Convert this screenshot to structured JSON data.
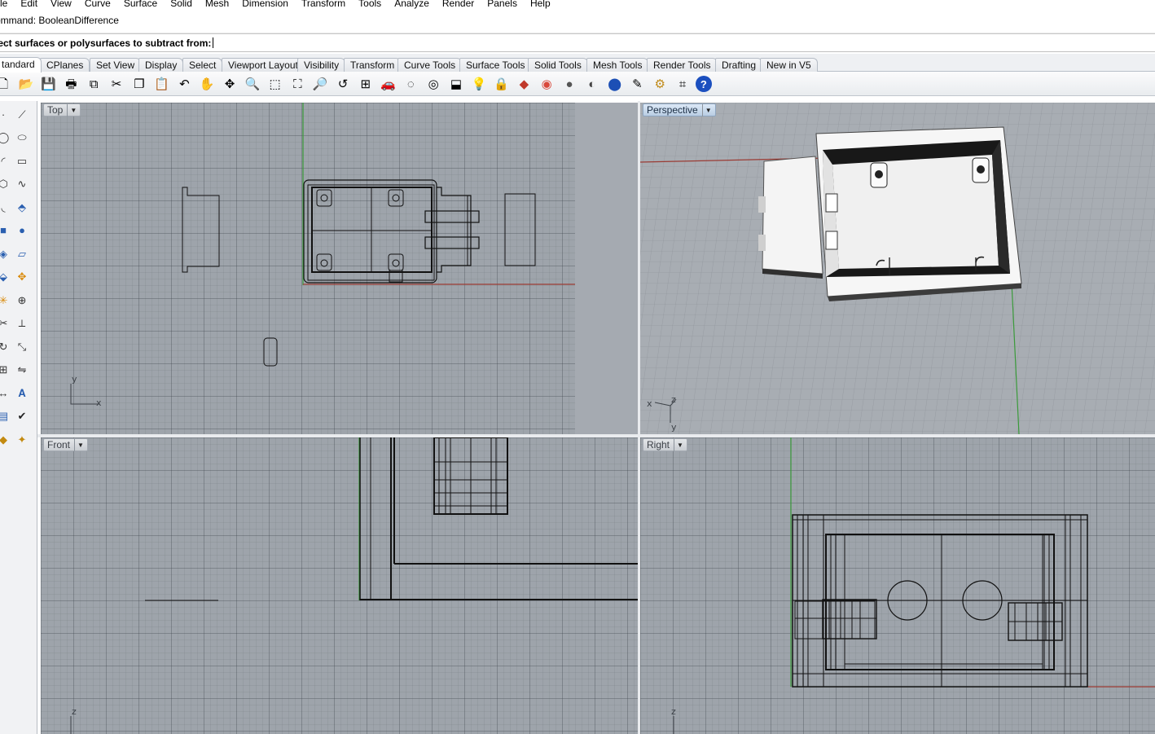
{
  "menu": [
    "le",
    "Edit",
    "View",
    "Curve",
    "Surface",
    "Solid",
    "Mesh",
    "Dimension",
    "Transform",
    "Tools",
    "Analyze",
    "Render",
    "Panels",
    "Help"
  ],
  "command": {
    "history": "ommand: BooleanDifference",
    "prompt": "lect surfaces or polysurfaces to subtract from:"
  },
  "tabs": [
    "tandard",
    "CPlanes",
    "Set View",
    "Display",
    "Select",
    "Viewport Layout",
    "Visibility",
    "Transform",
    "Curve Tools",
    "Surface Tools",
    "Solid Tools",
    "Mesh Tools",
    "Render Tools",
    "Drafting",
    "New in V5"
  ],
  "toolbar_icons": [
    "new-file-icon",
    "open-folder-icon",
    "save-icon",
    "print-icon",
    "import-icon",
    "cut-icon",
    "copy-icon",
    "paste-icon",
    "undo-icon",
    "pan-hand-icon",
    "rotate-view-icon",
    "zoom-dynamic-icon",
    "zoom-window-icon",
    "zoom-extents-icon",
    "zoom-selected-icon",
    "undo-view-icon",
    "four-viewports-icon",
    "car-object-icon",
    "hide-icon",
    "show-icon",
    "select-icon",
    "light-bulb-icon",
    "lock-icon",
    "layers-icon",
    "color-wheel-icon",
    "render-sphere-icon",
    "shaded-sphere-icon",
    "blue-sphere-icon",
    "options-pen-icon",
    "gear-icon",
    "grid-snap-icon",
    "help-icon"
  ],
  "viewports": {
    "top": {
      "label": "Top",
      "axis_x": "x",
      "axis_y": "y"
    },
    "perspective": {
      "label": "Perspective",
      "axis_x": "x",
      "axis_y": "y",
      "axis_z": "z"
    },
    "front": {
      "label": "Front",
      "axis_z": "z"
    },
    "right": {
      "label": "Right",
      "axis_z": "z"
    }
  }
}
